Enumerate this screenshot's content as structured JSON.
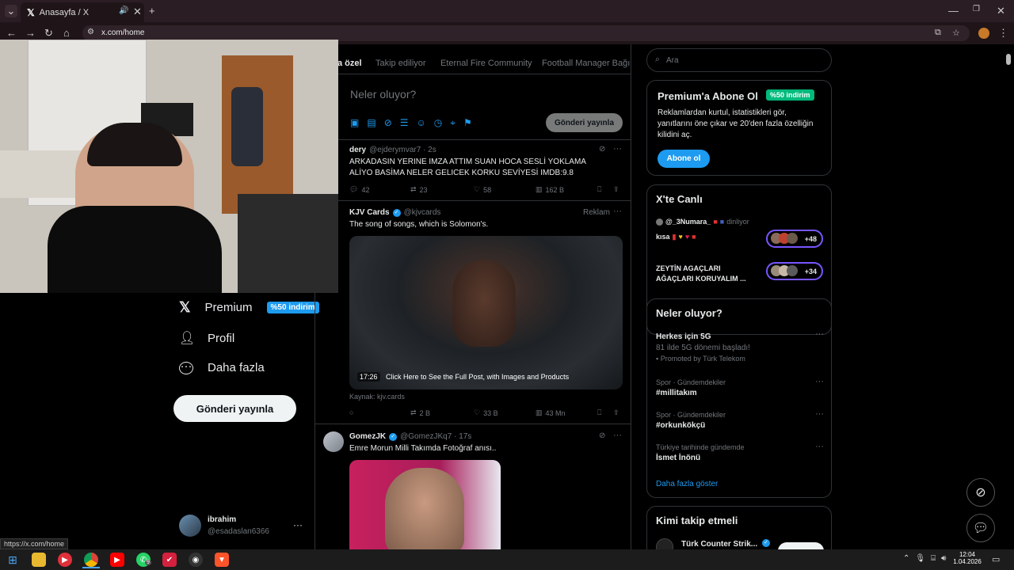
{
  "browser": {
    "tab_title": "Anasayfa / X",
    "url": "x.com/home",
    "status_url": "https://x.com/home"
  },
  "sidebar": {
    "premium_label": "Premium",
    "premium_badge": "%50 indirim",
    "profile_label": "Profil",
    "more_label": "Daha fazla",
    "post_button": "Gönderi yayınla",
    "user_name": "ibrahim",
    "user_handle": "@esadaslan6366"
  },
  "timeline": {
    "tabs": [
      "a özel",
      "Takip ediliyor",
      "Eternal Fire Community",
      "Football Manager Bağım"
    ],
    "compose_placeholder": "Neler oluyor?",
    "compose_button": "Gönderi yayınla",
    "tweets": [
      {
        "name": "dery",
        "handle": "@ejderymvar7 · 2s",
        "text": "ARKADASIN YERINE IMZA ATTIM SUAN HOCA SESLİ YOKLAMA ALİYO BASİMA NELER GELICEK KORKU SEVİYESİ IMDB:9.8",
        "replies": "42",
        "retweets": "23",
        "likes": "58",
        "views": "162 B"
      },
      {
        "name": "KJV Cards",
        "handle": "@kjvcards",
        "ad_label": "Reklam",
        "text": "The song of songs, which is Solomon's.",
        "video_time": "17:26",
        "video_caption": "Click Here to See the Full Post, with Images and Products",
        "source": "Kaynak: kjv.cards",
        "retweets": "2 B",
        "likes": "33 B",
        "views": "43 Mn"
      },
      {
        "name": "GomezJK",
        "handle": "@GomezJKq7 · 17s",
        "text": "Emre Morun Milli Takımda Fotoğraf anısı.."
      }
    ]
  },
  "right": {
    "search_placeholder": "Ara",
    "premium_title": "Premium'a Abone Ol",
    "premium_badge": "%50 indirim",
    "premium_text": "Reklamlardan kurtul, istatistikleri gör, yanıtlarını öne çıkar ve 20'den fazla özelliğin kilidini aç.",
    "premium_button": "Abone ol",
    "live_title": "X'te Canlı",
    "live_items": [
      {
        "host": "@_3Numara_",
        "status": "dinliyor",
        "title": "kısa",
        "count": "+48"
      },
      {
        "title": "ZEYTİN AGAÇLARI AĞAÇLARI KORUYALIM ...",
        "count": "+34"
      }
    ],
    "trends_title": "Neler oluyor?",
    "trends": [
      {
        "category": "",
        "name": "Herkes için 5G",
        "sub": "81 ilde 5G dönemi başladı!",
        "promo": "Promoted by Türk Telekom"
      },
      {
        "category": "Spor · Gündemdekiler",
        "name": "#millitakım"
      },
      {
        "category": "Spor · Gündemdekiler",
        "name": "#orkunkökçü"
      },
      {
        "category": "Türkiye tarihinde gündemde",
        "name": "İsmet İnönü"
      }
    ],
    "show_more": "Daha fazla göster",
    "follow_title": "Kimi takip etmeli",
    "follow_name": "Türk Counter Strik..."
  },
  "taskbar": {
    "time": "12:04",
    "date": "1.04.2026",
    "whatsapp_badge": "9"
  },
  "colors": {
    "accent": "#1d9bf0",
    "browser_frame": "#2b1d24",
    "green_badge": "#00ba7c"
  }
}
